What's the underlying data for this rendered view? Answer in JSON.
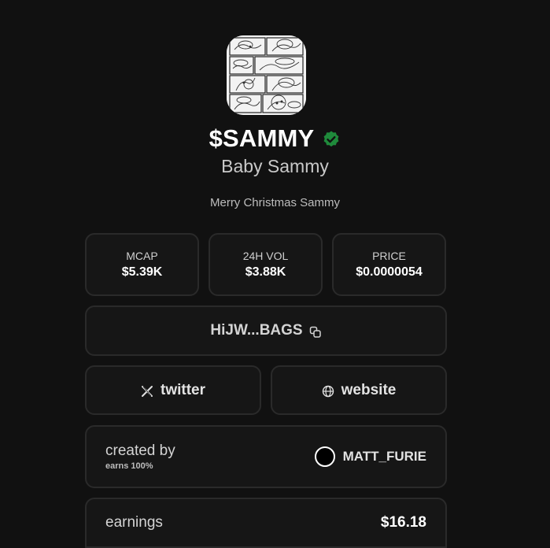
{
  "token": {
    "ticker": "$SAMMY",
    "name": "Baby Sammy",
    "description": "Merry Christmas Sammy",
    "verified": true,
    "image_icon": "comic-strip-image",
    "verified_color": "#1f8a3b"
  },
  "stats": [
    {
      "label": "MCAP",
      "value": "$5.39K"
    },
    {
      "label": "24H VOL",
      "value": "$3.88K"
    },
    {
      "label": "PRICE",
      "value": "$0.0000054"
    }
  ],
  "contract": {
    "address": "HiJW...BAGS",
    "copy_icon": "copy-icon"
  },
  "links": {
    "twitter": {
      "label": "twitter",
      "icon": "x-logo-icon"
    },
    "website": {
      "label": "website",
      "icon": "globe-icon"
    }
  },
  "creator": {
    "created_label": "created by",
    "earns_label": "earns 100%",
    "name": "MATT_FURIE",
    "avatar_icon": "avatar-circle"
  },
  "earnings": {
    "label": "earnings",
    "value": "$16.18"
  },
  "colors": {
    "background": "#111111",
    "card": "#161616",
    "card_border": "#2a2a2a",
    "text": "#ffffff"
  }
}
